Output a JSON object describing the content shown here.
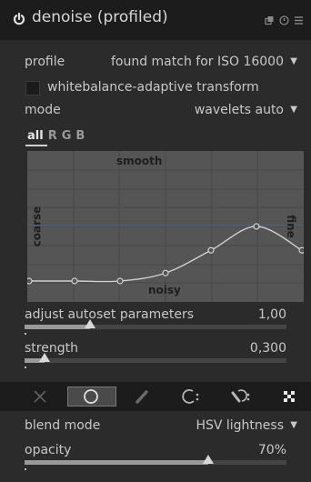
{
  "module": {
    "title": "denoise (profiled)"
  },
  "profile": {
    "label": "profile",
    "value": "found match for ISO 16000"
  },
  "wb_adaptive": {
    "label": "whitebalance-adaptive transform",
    "checked": false
  },
  "mode": {
    "label": "mode",
    "value": "wavelets auto"
  },
  "channels": {
    "tabs": [
      "all",
      "R",
      "G",
      "B"
    ],
    "active": "all"
  },
  "curve": {
    "label_top": "smooth",
    "label_bottom": "noisy",
    "label_left": "coarse",
    "label_right": "fine",
    "points_y": [
      0.0,
      0.0,
      0.0,
      0.07,
      0.27,
      0.48,
      0.27
    ]
  },
  "adjust_autoset": {
    "label": "adjust autoset parameters",
    "value": "1,00",
    "fraction": 0.25
  },
  "strength": {
    "label": "strength",
    "value": "0,300",
    "fraction": 0.075
  },
  "blend_toolbar": {
    "items": [
      "off-icon",
      "uniformly-icon",
      "drawn-mask-icon",
      "parametric-mask-icon",
      "drawn-parametric-mask-icon",
      "raster-mask-icon"
    ],
    "active": "uniformly-icon"
  },
  "blend_mode": {
    "label": "blend mode",
    "value": "HSV lightness"
  },
  "opacity": {
    "label": "opacity",
    "value": "70%",
    "fraction": 0.7
  },
  "colors": {
    "panel_bg": "#2b2b2b",
    "header_bg": "#1c1c1c",
    "graph_bg": "#555555",
    "curve": "#d0d0d0",
    "text": "#c8c8c8"
  }
}
